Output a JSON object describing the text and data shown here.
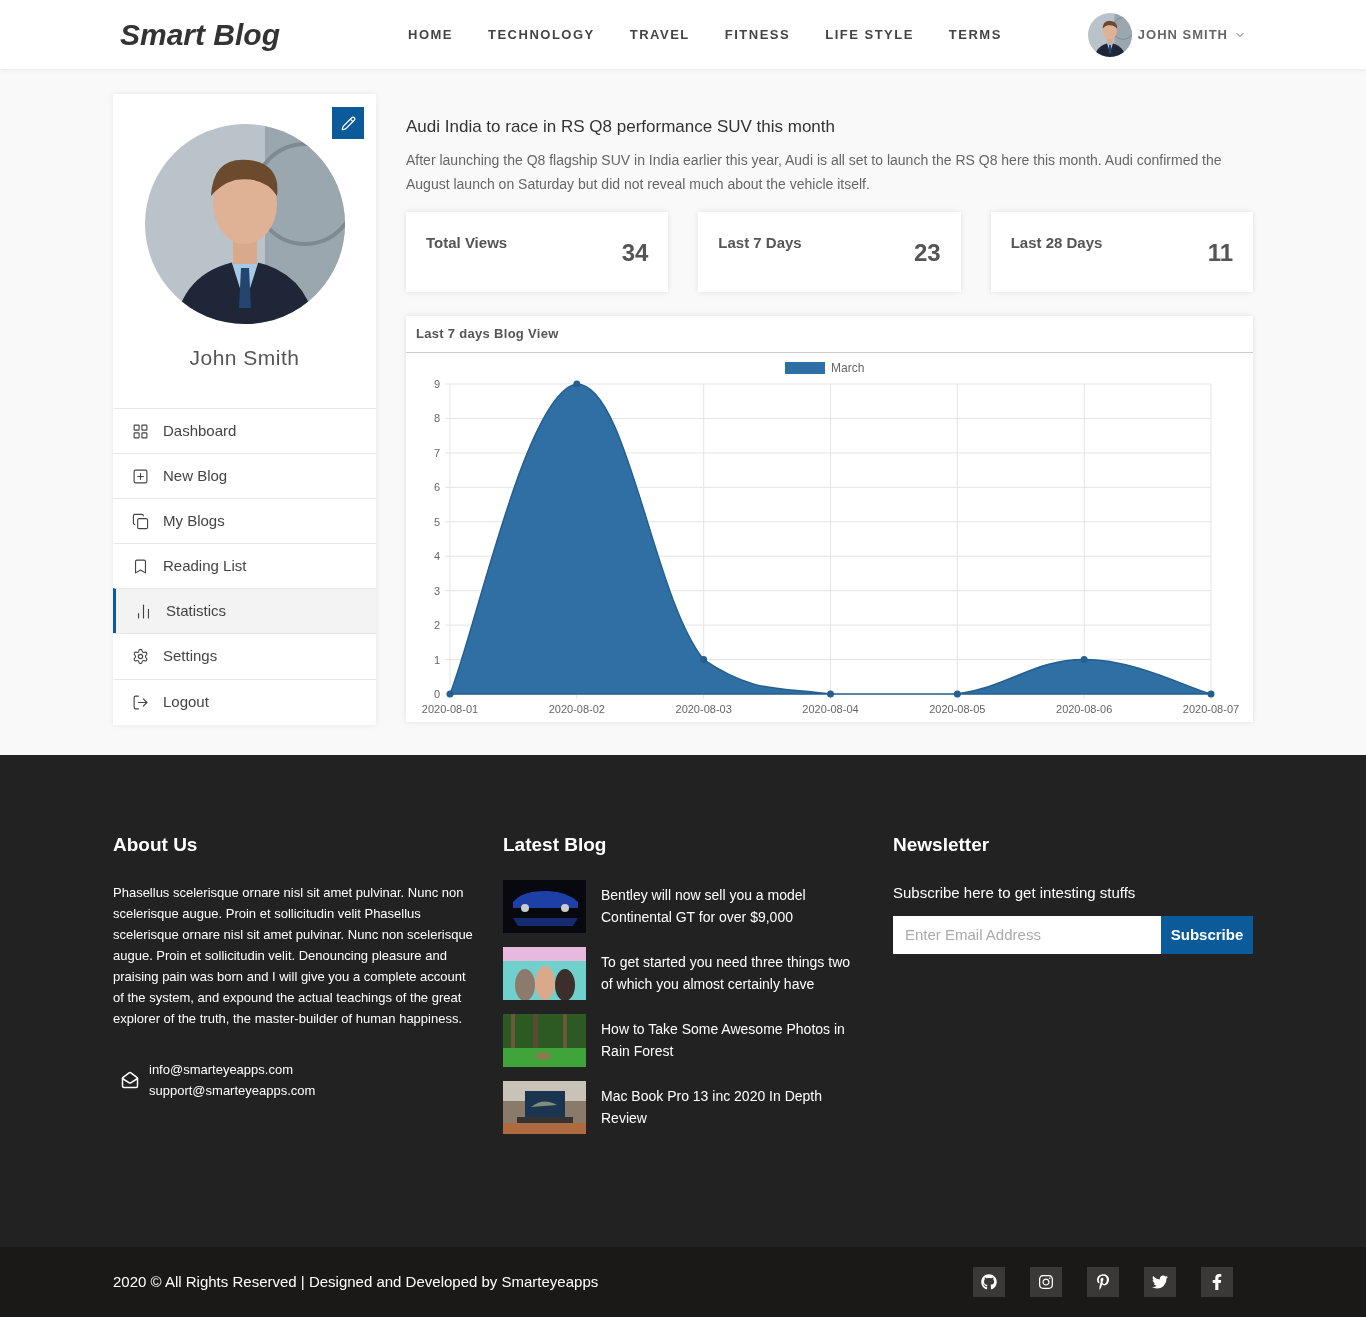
{
  "header": {
    "brand": "Smart Blog",
    "nav": [
      "HOME",
      "TECHNOLOGY",
      "TRAVEL",
      "FITNESS",
      "LIFE STYLE",
      "TERMS"
    ],
    "user": "JOHN SMITH"
  },
  "profile": {
    "name": "John Smith"
  },
  "sidebar": {
    "items": [
      {
        "label": "Dashboard",
        "selected": false
      },
      {
        "label": "New Blog",
        "selected": false
      },
      {
        "label": "My Blogs",
        "selected": false
      },
      {
        "label": "Reading List",
        "selected": false
      },
      {
        "label": "Statistics",
        "selected": true
      },
      {
        "label": "Settings",
        "selected": false
      },
      {
        "label": "Logout",
        "selected": false
      }
    ]
  },
  "article": {
    "title": "Audi India to race in RS Q8 performance SUV this month",
    "body": "After launching the Q8 flagship SUV in India earlier this year, Audi is all set to launch the RS Q8 here this month. Audi confirmed the August launch on Saturday but did not reveal much about the vehicle itself."
  },
  "stats": [
    {
      "label": "Total Views",
      "value": "34"
    },
    {
      "label": "Last 7 Days",
      "value": "23"
    },
    {
      "label": "Last 28 Days",
      "value": "11"
    }
  ],
  "chart_panel": {
    "title": "Last 7 days Blog View",
    "chart_data": {
      "type": "area",
      "categories": [
        "2020-08-01",
        "2020-08-02",
        "2020-08-03",
        "2020-08-04",
        "2020-08-05",
        "2020-08-06",
        "2020-08-07"
      ],
      "series": [
        {
          "name": "March",
          "color": "#2f6fa4",
          "values": [
            0,
            9,
            1,
            0,
            0,
            1,
            0
          ]
        }
      ],
      "ylim": [
        0,
        9
      ],
      "grid": true,
      "yticks": [
        0,
        1,
        2,
        3,
        4,
        5,
        6,
        7,
        8,
        9
      ]
    }
  },
  "footer": {
    "about": {
      "title": "About Us",
      "text": "Phasellus scelerisque ornare nisl sit amet pulvinar. Nunc non scelerisque augue. Proin et sollicitudin velit Phasellus scelerisque ornare nisl sit amet pulvinar. Nunc non scelerisque augue. Proin et sollicitudin velit. Denouncing pleasure and praising pain was born and I will give you a complete account of the system, and expound the actual teachings of the great explorer of the truth, the master-builder of human happiness.",
      "emails": [
        "info@smarteyeapps.com",
        "support@smarteyeapps.com"
      ]
    },
    "latest_blog": {
      "title": "Latest Blog",
      "posts": [
        {
          "title": "Bentley will now sell you a model Continental GT for over $9,000"
        },
        {
          "title": "To get started you need three things two of which you almost certainly have"
        },
        {
          "title": "How to Take Some Awesome Photos in Rain Forest"
        },
        {
          "title": "Mac Book Pro 13 inc 2020 In Depth Review"
        }
      ]
    },
    "newsletter": {
      "title": "Newsletter",
      "subtitle": "Subscribe here to get intesting stuffs",
      "placeholder": "Enter Email Address",
      "button": "Subscribe"
    }
  },
  "bottom_bar": {
    "copyright": "2020 © All Rights Reserved | Designed and Developed by Smarteyeapps"
  }
}
